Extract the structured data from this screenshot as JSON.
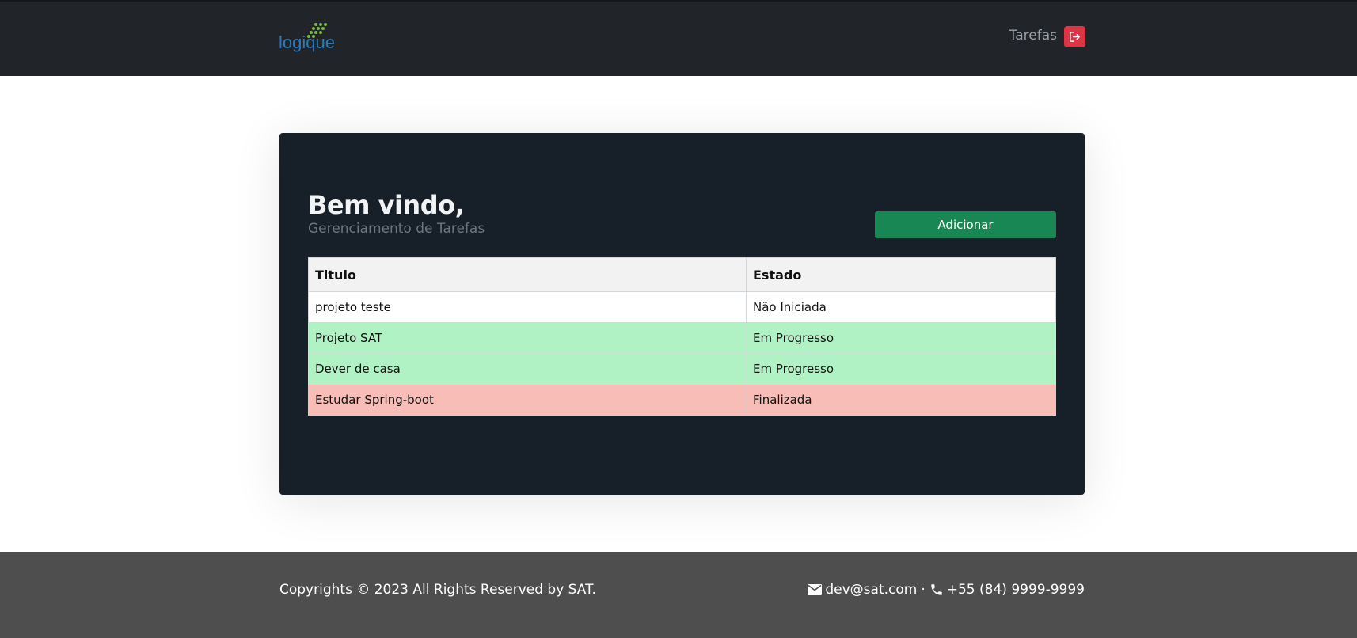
{
  "header": {
    "logo_text": "logique",
    "nav_link": "Tarefas",
    "logout_icon": "logout-icon",
    "colors": {
      "background": "#212529",
      "logout": "#dc3545"
    }
  },
  "card": {
    "title": "Bem vindo,",
    "subtitle": "Gerenciamento de Tarefas",
    "add_button": "Adicionar",
    "table": {
      "headers": [
        "Titulo",
        "Estado"
      ],
      "rows": [
        {
          "titulo": "projeto teste",
          "estado": "Não Iniciada",
          "status": "not-started"
        },
        {
          "titulo": "Projeto SAT",
          "estado": "Em Progresso",
          "status": "in-progress"
        },
        {
          "titulo": "Dever de casa",
          "estado": "Em Progresso",
          "status": "in-progress"
        },
        {
          "titulo": "Estudar Spring-boot",
          "estado": "Finalizada",
          "status": "finished"
        }
      ]
    },
    "colors": {
      "background": "#171f28",
      "add_button": "#198754",
      "in_progress": "#b1f2c4",
      "finished": "#f7bdb6"
    }
  },
  "footer": {
    "copyright": "Copyrights © 2023 All Rights Reserved by SAT.",
    "email": "dev@sat.com",
    "separator": "·",
    "phone": "+55 (84) 9999-9999",
    "icons": [
      "envelope-icon",
      "phone-icon"
    ]
  }
}
